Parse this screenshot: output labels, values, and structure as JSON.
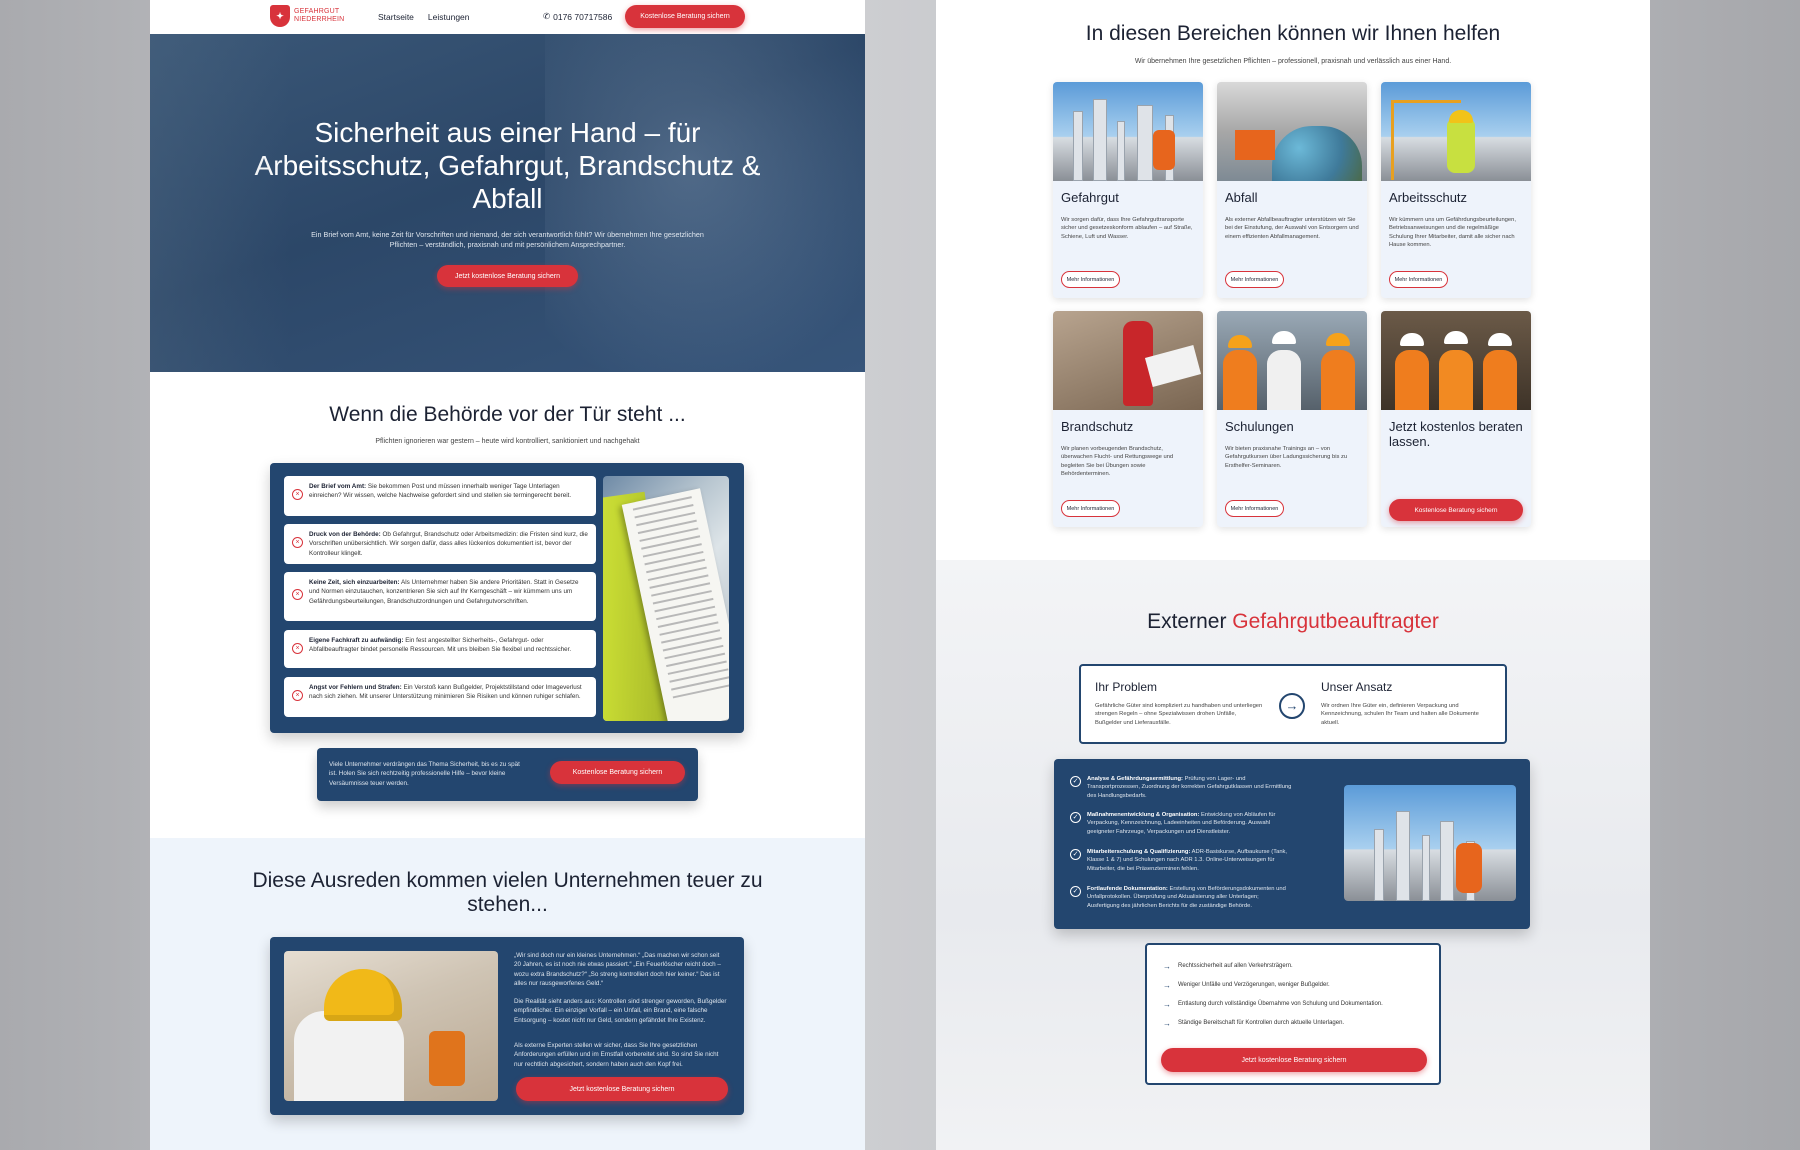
{
  "colors": {
    "brand_red": "#d8333b",
    "brand_navy": "#23466f",
    "hero_bg": "#2c4768"
  },
  "nav": {
    "logo_line1": "GEFAHRGUT",
    "logo_line2": "NIEDERRHEIN",
    "links": [
      "Startseite",
      "Leistungen"
    ],
    "phone": "0176 70717586",
    "cta": "Kostenlose Beratung sichern"
  },
  "hero": {
    "title": "Sicherheit aus einer Hand – für Arbeitsschutz, Gefahrgut, Brandschutz & Abfall",
    "text": "Ein Brief vom Amt, keine Zeit für Vorschriften und niemand, der sich verantwortlich fühlt? Wir übernehmen Ihre gesetzlichen Pflichten – verständlich, praxisnah und mit persönlichem Ansprechpartner.",
    "cta": "Jetzt kostenlose Beratung sichern"
  },
  "authority": {
    "title": "Wenn die Behörde vor der Tür steht ...",
    "subtitle": "Pflichten ignorieren war gestern – heute wird kontrolliert, sanktioniert und nachgehakt",
    "problems": [
      {
        "bold": "Der Brief vom Amt:",
        "text": " Sie bekommen Post und müssen innerhalb weniger Tage Unterlagen einreichen? Wir wissen, welche Nachweise gefordert sind und stellen sie termingerecht bereit."
      },
      {
        "bold": "Druck von der Behörde:",
        "text": " Ob Gefahrgut, Brandschutz oder Arbeitsmedizin: die Fristen sind kurz, die Vorschriften unübersichtlich. Wir sorgen dafür, dass alles lückenlos dokumentiert ist, bevor der Kontrolleur klingelt."
      },
      {
        "bold": "Keine Zeit, sich einzuarbeiten:",
        "text": " Als Unternehmer haben Sie andere Prioritäten. Statt in Gesetze und Normen einzutauchen, konzentrieren Sie sich auf Ihr Kerngeschäft – wir kümmern uns um Gefährdungsbeurteilungen, Brandschutzordnungen und Gefahrgutvorschriften."
      },
      {
        "bold": "Eigene Fachkraft zu aufwändig:",
        "text": " Ein fest angestellter Sicherheits-, Gefahrgut- oder Abfallbeauftragter bindet personelle Ressourcen. Mit uns bleiben Sie flexibel und rechtssicher."
      },
      {
        "bold": "Angst vor Fehlern und Strafen:",
        "text": " Ein Verstoß kann Bußgelder, Projektstillstand oder Imageverlust nach sich ziehen. Mit unserer Unterstützung minimieren Sie Risiken und können ruhiger schlafen."
      }
    ],
    "cta_text": "Viele Unternehmer verdrängen das Thema Sicherheit, bis es zu spät ist. Holen Sie sich rechtzeitig professionelle Hilfe – bevor kleine Versäumnisse teuer werden.",
    "cta": "Kostenlose Beratung sichern"
  },
  "excuses": {
    "title": "Diese Ausreden kommen vielen Unternehmen teuer zu stehen...",
    "paragraphs": [
      "„Wir sind doch nur ein kleines Unternehmen.“ „Das machen wir schon seit 20 Jahren, es ist noch nie etwas passiert.“ „Ein Feuerlöscher reicht doch – wozu extra Brandschutz?“ „So streng kontrolliert doch hier keiner.“ Das ist alles nur rausgeworfenes Geld.“",
      "Die Realität sieht anders aus: Kontrollen sind strenger geworden, Bußgelder empfindlicher. Ein einziger Vorfall – ein Unfall, ein Brand, eine falsche Entsorgung – kostet nicht nur Geld, sondern gefährdet Ihre Existenz.",
      "Als externe Experten stellen wir sicher, dass Sie Ihre gesetzlichen Anforderungen erfüllen und im Ernstfall vorbereitet sind. So sind Sie nicht nur rechtlich abgesichert, sondern haben auch den Kopf frei."
    ],
    "cta": "Jetzt kostenlose Beratung sichern"
  },
  "services": {
    "title": "In diesen Bereichen können wir Ihnen helfen",
    "subtitle": "Wir übernehmen Ihre gesetzlichen Pflichten – professionell, praxisnah und verlässlich aus einer Hand.",
    "more": "Mehr Informationen",
    "cards": [
      {
        "title": "Gefahrgut",
        "text": "Wir sorgen dafür, dass Ihre Gefahrguttransporte sicher und gesetzeskonform ablaufen – auf Straße, Schiene, Luft und Wasser."
      },
      {
        "title": "Abfall",
        "text": "Als externer Abfallbeauftragter unterstützen wir Sie bei der Einstufung, der Auswahl von Entsorgern und einem effizienten Abfallmanagement."
      },
      {
        "title": "Arbeitsschutz",
        "text": "Wir kümmern uns um Gefährdungsbeurteilungen, Betriebsanweisungen und die regelmäßige Schulung Ihrer Mitarbeiter, damit alle sicher nach Hause kommen."
      },
      {
        "title": "Brandschutz",
        "text": "Wir planen vorbeugenden Brandschutz, überwachen Flucht- und Rettungswege und begleiten Sie bei Übungen sowie Behördenterminen."
      },
      {
        "title": "Schulungen",
        "text": "Wir bieten praxisnahe Trainings an – von Gefahrgutkursen über Ladungssicherung bis zu Ersthelfer-Seminaren."
      },
      {
        "title": "Jetzt kostenlos beraten lassen.",
        "cta": "Kostenlose Beratung sichern"
      }
    ]
  },
  "external": {
    "title_plain": "Externer ",
    "title_accent": "Gefahrgutbeauftragter",
    "problem_title": "Ihr Problem",
    "problem_text": "Gefährliche Güter sind kompliziert zu handhaben und unterliegen strengen Regeln – ohne Spezialwissen drohen Unfälle, Bußgelder und Lieferausfälle.",
    "approach_title": "Unser Ansatz",
    "approach_text": "Wir ordnen Ihre Güter ein, definieren Verpackung und Kennzeichnung, schulen Ihr Team und halten alle Dokumente aktuell.",
    "steps": [
      {
        "bold": "Analyse & Gefährdungsermittlung:",
        "text": " Prüfung von Lager- und Transportprozessen, Zuordnung der korrekten Gefahrgutklassen und Ermittlung des Handlungsbedarfs."
      },
      {
        "bold": "Maßnahmenentwicklung & Organisation:",
        "text": " Entwicklung von Abläufen für Verpackung, Kennzeichnung, Ladeeinheiten und Beförderung. Auswahl geeigneter Fahrzeuge, Verpackungen und Dienstleister."
      },
      {
        "bold": "Mitarbeiterschulung & Qualifizierung:",
        "text": " ADR-Basiskurse, Aufbaukurse (Tank, Klasse 1 & 7) und Schulungen nach ADR 1.3. Online-Unterweisungen für Mitarbeiter, die bei Präsenzterminen fehlen."
      },
      {
        "bold": "Fortlaufende Dokumentation:",
        "text": " Erstellung von Beförderungsdokumenten und Unfallprotokollen. Überprüfung und Aktualisierung aller Unterlagen; Ausfertigung des jährlichen Berichts für die zuständige Behörde."
      }
    ],
    "benefits": [
      "Rechtssicherheit auf allen Verkehrsträgern.",
      "Weniger Unfälle und Verzögerungen, weniger Bußgelder.",
      "Entlastung durch vollständige Übernahme von Schulung und Dokumentation.",
      "Ständige Bereitschaft für Kontrollen durch aktuelle Unterlagen."
    ],
    "cta": "Jetzt kostenlose Beratung sichern"
  }
}
